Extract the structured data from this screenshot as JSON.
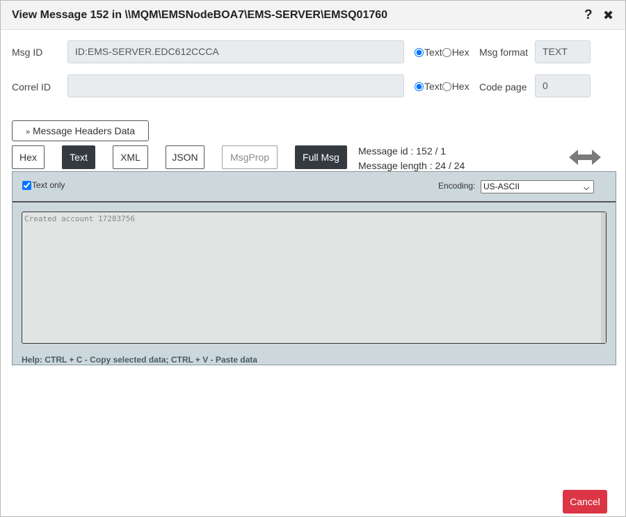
{
  "window": {
    "title": "View Message 152 in \\\\MQM\\EMSNodeBOA7\\EMS-SERVER\\EMSQ01760",
    "help_icon": "help-icon",
    "close_icon": "close-icon"
  },
  "fields": {
    "msg_id": {
      "label": "Msg ID",
      "value": "ID:EMS-SERVER.EDC612CCCA"
    },
    "correl_id": {
      "label": "Correl ID",
      "value": ""
    },
    "msg_id_encoding": {
      "text_label": "Text",
      "hex_label": "Hex",
      "selected": "Text"
    },
    "correl_id_encoding": {
      "text_label": "Text",
      "hex_label": "Hex",
      "selected": "Text"
    },
    "msg_format": {
      "label": "Msg format",
      "value": "TEXT"
    },
    "code_page": {
      "label": "Code page",
      "value": "0"
    }
  },
  "headers_button": {
    "icon": "double-chevron-down-icon",
    "label": "Message Headers Data"
  },
  "format_buttons": [
    {
      "label": "Hex",
      "state": "normal"
    },
    {
      "label": "Text",
      "state": "active"
    },
    {
      "label": "XML",
      "state": "normal"
    },
    {
      "label": "JSON",
      "state": "normal"
    },
    {
      "label": "MsgProp",
      "state": "disabled"
    },
    {
      "label": "Full Msg",
      "state": "active"
    }
  ],
  "message_info": {
    "id_line": "Message id : 152 / 1",
    "length_line": "Message length : 24 / 24"
  },
  "expand_icon": "horizontal-double-arrow-icon",
  "panel": {
    "text_only_label": "Text only",
    "text_only_checked": true,
    "encoding_label": "Encoding:",
    "encoding_value": "US-ASCII",
    "message_body": "Created account 17283756",
    "help": "Help: CTRL + C - Copy selected data; CTRL + V - Paste data"
  },
  "footer": {
    "cancel_label": "Cancel"
  },
  "colors": {
    "active_button": "#343a40",
    "cancel": "#dc3545",
    "panel_bg": "#cdd8dc"
  }
}
